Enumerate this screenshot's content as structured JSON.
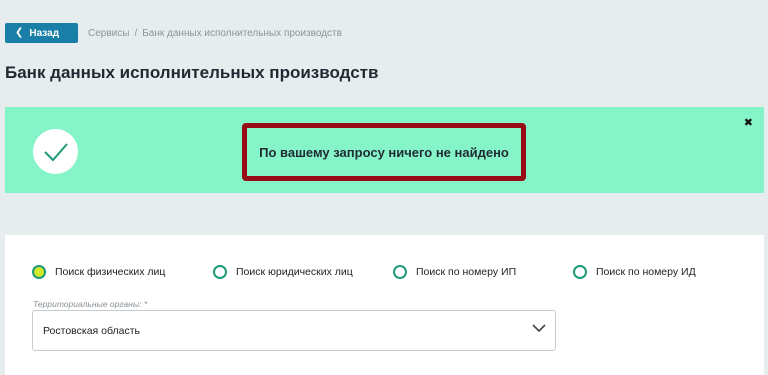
{
  "header": {
    "back_label": "Назад",
    "breadcrumb": [
      "Сервисы",
      "/",
      "Банк данных исполнительных производств"
    ]
  },
  "page_title": "Банк данных исполнительных производств",
  "alert": {
    "message": "По вашему запросу ничего не найдено",
    "close_label": "✖",
    "bg_color": "#85f5c9",
    "highlight_color": "#9a0a16"
  },
  "search": {
    "options": [
      {
        "label": "Поиск физических лиц",
        "selected": true
      },
      {
        "label": "Поиск юридических лиц",
        "selected": false
      },
      {
        "label": "Поиск по номеру ИП",
        "selected": false
      },
      {
        "label": "Поиск по номеру ИД",
        "selected": false
      }
    ],
    "territory_label": "Территориальные органы: *",
    "territory_value": "Ростовская область"
  }
}
